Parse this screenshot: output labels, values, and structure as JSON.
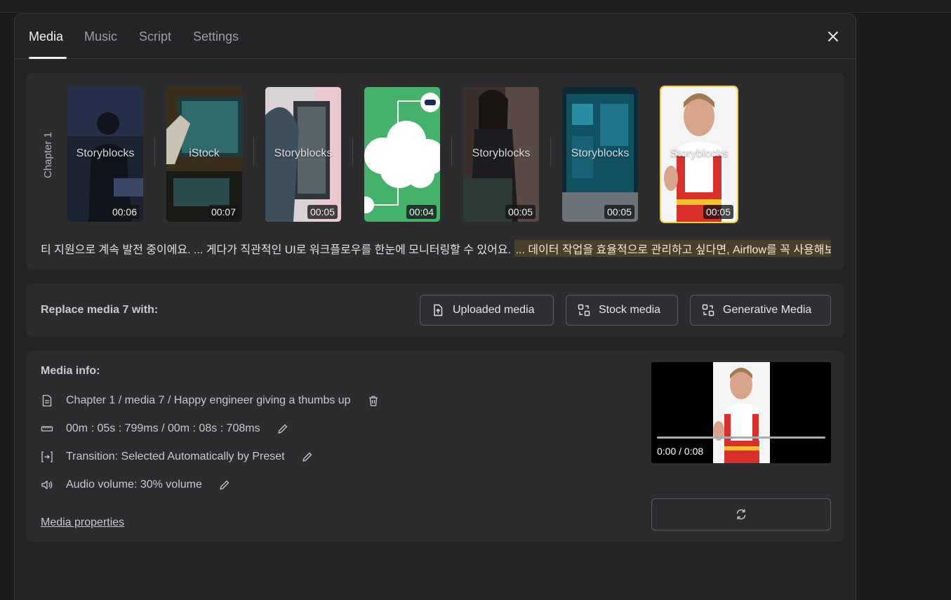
{
  "tabs": [
    "Media",
    "Music",
    "Script",
    "Settings"
  ],
  "chapter": {
    "label": "Chapter 1"
  },
  "thumbnails": [
    {
      "source": "Storyblocks",
      "duration": "00:06"
    },
    {
      "source": "iStock",
      "duration": "00:07"
    },
    {
      "source": "Storyblocks",
      "duration": "00:05"
    },
    {
      "source": "",
      "duration": "00:04"
    },
    {
      "source": "Storyblocks",
      "duration": "00:05"
    },
    {
      "source": "Storyblocks",
      "duration": "00:05"
    },
    {
      "source": "Storyblocks",
      "duration": "00:05"
    }
  ],
  "script": {
    "normal": "티 지원으로 계속 발전 중이에요. ... 게다가 직관적인 UI로 워크플로우를 한눈에 모니터링할 수 있어요.",
    "highlighted": "... 데이터 작업을 효율적으로 관리하고 싶다면, Airflow를 꼭 사용해보세요! ..."
  },
  "replace": {
    "label": "Replace media 7 with:",
    "buttons": [
      "Uploaded media",
      "Stock media",
      "Generative Media"
    ]
  },
  "info": {
    "title": "Media info:",
    "path": "Chapter 1 / media 7 / Happy engineer giving a thumbs up",
    "timing": "00m : 05s : 799ms / 00m : 08s : 708ms",
    "transition": "Transition: Selected Automatically by Preset",
    "audio": "Audio volume: 30% volume",
    "properties_link": "Media properties"
  },
  "player": {
    "time": "0:00 / 0:08"
  },
  "colors": {
    "highlight": "#4a3f2a",
    "selected_outline": "#f4d03f"
  }
}
